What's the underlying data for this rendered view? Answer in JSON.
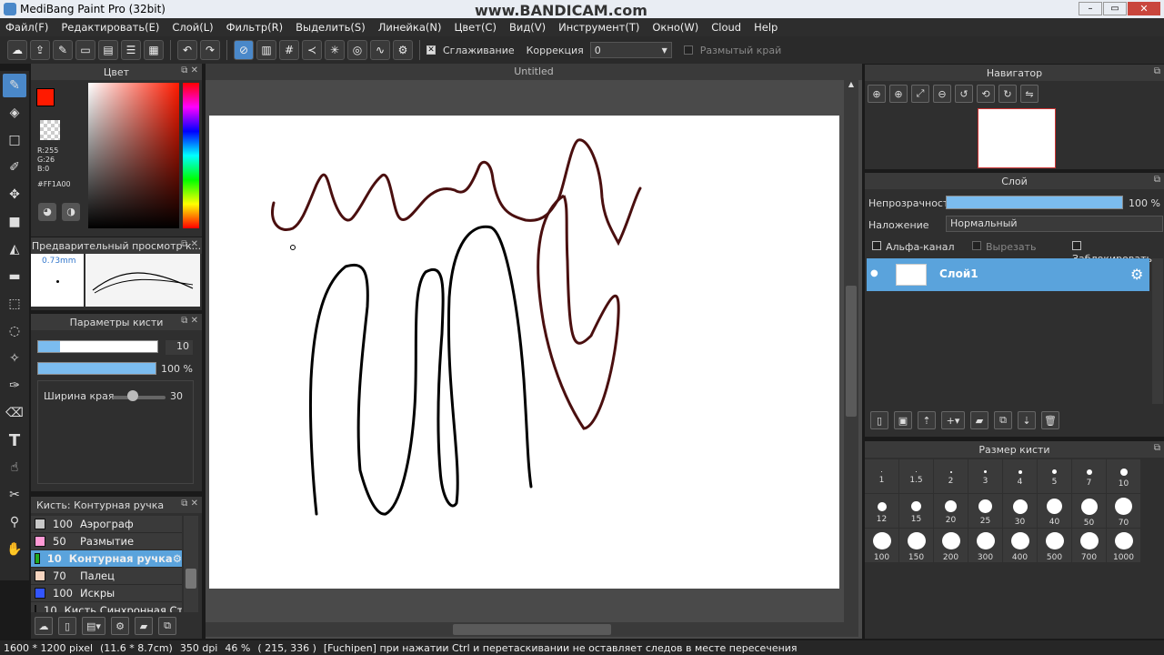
{
  "window": {
    "title": "MediBang Paint Pro (32bit)",
    "watermark": "www.BANDICAM.com"
  },
  "menu": [
    "Файл(F)",
    "Редактировать(E)",
    "Слой(L)",
    "Фильтр(R)",
    "Выделить(S)",
    "Линейка(N)",
    "Цвет(C)",
    "Вид(V)",
    "Инструмент(T)",
    "Окно(W)",
    "Cloud",
    "Help"
  ],
  "toolbar": {
    "antialias_label": "Сглаживание",
    "correction_label": "Коррекция",
    "correction_value": "0",
    "blur_edge_label": "Размытый край"
  },
  "color_panel": {
    "title": "Цвет",
    "r": "R:255",
    "g": "G:26",
    "b": "B:0",
    "hex": "#FF1A00",
    "fg_color": "#ff1a00"
  },
  "brush_preview": {
    "title": "Предварительный просмотр к...",
    "size": "0.73mm"
  },
  "brush_params": {
    "title": "Параметры кисти",
    "size_value": "10",
    "opacity_value": "100 %",
    "edge_label": "Ширина края",
    "edge_value": "30"
  },
  "brush_list": {
    "title": "Кисть: Контурная ручка",
    "items": [
      {
        "size": "100",
        "name": "Аэрограф",
        "color": "#c8c8c8"
      },
      {
        "size": "50",
        "name": "Размытие",
        "color": "#ff9ad6"
      },
      {
        "size": "10",
        "name": "Контурная ручка",
        "color": "#22aa22",
        "selected": true
      },
      {
        "size": "70",
        "name": "Палец",
        "color": "#f6d5c0"
      },
      {
        "size": "100",
        "name": "Искры",
        "color": "#3355ff"
      },
      {
        "size": "10",
        "name": "Кисть  Синхронная Ст",
        "color": "#ee3333"
      }
    ]
  },
  "canvas": {
    "tab_title": "Untitled"
  },
  "navigator": {
    "title": "Навигатор"
  },
  "layers": {
    "title": "Слой",
    "opacity_label": "Непрозрачность",
    "opacity_value": "100 %",
    "blend_label": "Наложение",
    "blend_value": "Нормальный",
    "alpha_label": "Альфа-канал",
    "clip_label": "Вырезать",
    "lock_label": "Заблокировать",
    "layer_name": "Слой1"
  },
  "brush_size": {
    "title": "Размер кисти",
    "sizes": [
      "1",
      "1.5",
      "2",
      "3",
      "4",
      "5",
      "7",
      "10",
      "12",
      "15",
      "20",
      "25",
      "30",
      "40",
      "50",
      "70",
      "100",
      "150",
      "200",
      "300",
      "400",
      "500",
      "700",
      "1000"
    ]
  },
  "status": {
    "dims": "1600 * 1200 pixel",
    "cm": "(11.6 * 8.7cm)",
    "dpi": "350 dpi",
    "zoom": "46 %",
    "coords": "( 215, 336 )",
    "hint": "[Fuchipen] при нажатии Ctrl и перетаскивании не оставляет следов в месте пересечения"
  }
}
